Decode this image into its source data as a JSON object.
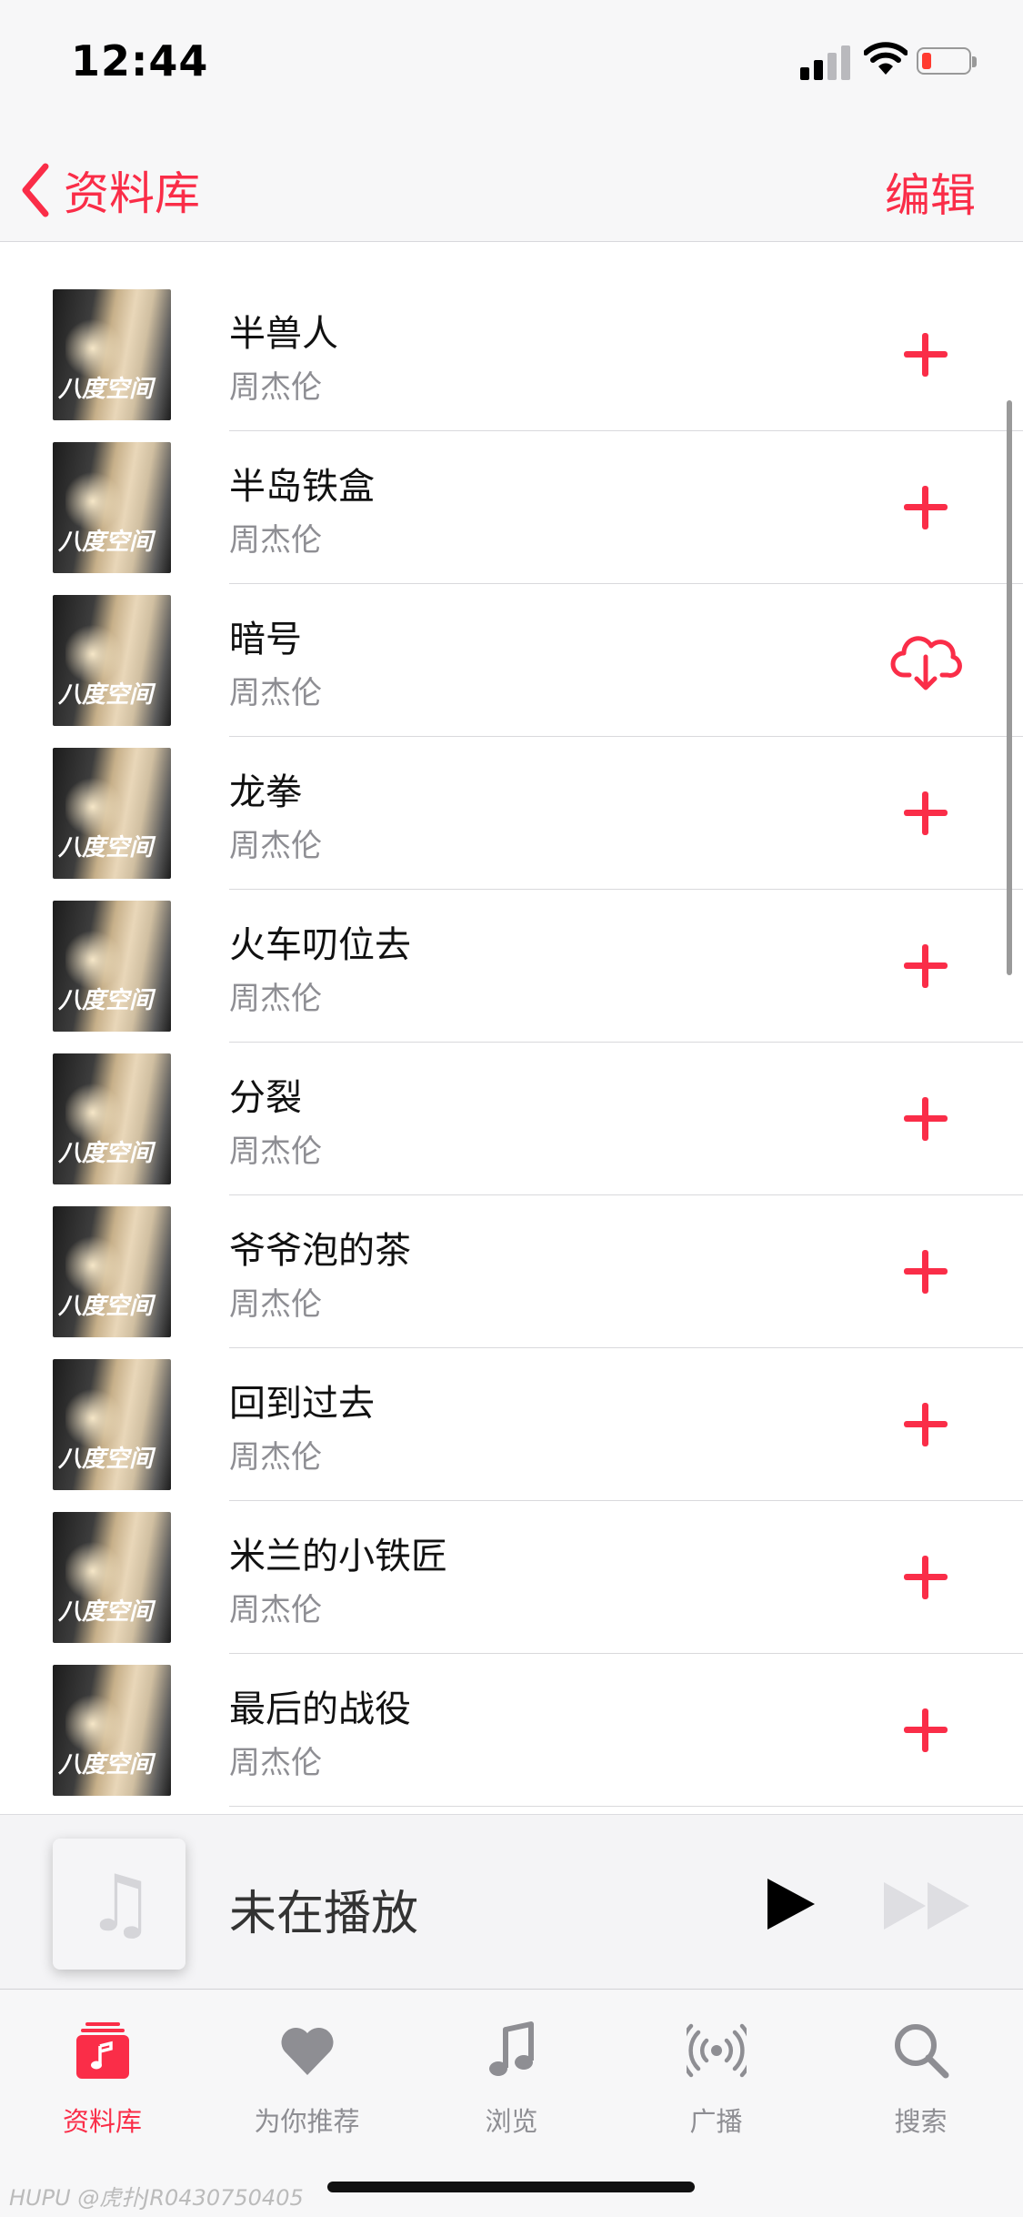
{
  "status_bar": {
    "time": "12:44"
  },
  "nav": {
    "back_label": "资料库",
    "edit_label": "编辑"
  },
  "songs": [
    {
      "title": "半兽人",
      "artist": "周杰伦",
      "action": "add-icon"
    },
    {
      "title": "半岛铁盒",
      "artist": "周杰伦",
      "action": "add-icon"
    },
    {
      "title": "暗号",
      "artist": "周杰伦",
      "action": "cloud-download-icon"
    },
    {
      "title": "龙拳",
      "artist": "周杰伦",
      "action": "add-icon"
    },
    {
      "title": "火车叨位去",
      "artist": "周杰伦",
      "action": "add-icon"
    },
    {
      "title": "分裂",
      "artist": "周杰伦",
      "action": "add-icon"
    },
    {
      "title": "爷爷泡的茶",
      "artist": "周杰伦",
      "action": "add-icon"
    },
    {
      "title": "回到过去",
      "artist": "周杰伦",
      "action": "add-icon"
    },
    {
      "title": "米兰的小铁匠",
      "artist": "周杰伦",
      "action": "add-icon"
    },
    {
      "title": "最后的战役",
      "artist": "周杰伦",
      "action": "add-icon"
    }
  ],
  "mini_player": {
    "title": "未在播放"
  },
  "tabs": [
    {
      "label": "资料库",
      "icon": "library-icon",
      "active": true
    },
    {
      "label": "为你推荐",
      "icon": "heart-icon",
      "active": false
    },
    {
      "label": "浏览",
      "icon": "music-note-icon",
      "active": false
    },
    {
      "label": "广播",
      "icon": "radio-icon",
      "active": false
    },
    {
      "label": "搜索",
      "icon": "search-icon",
      "active": false
    }
  ],
  "watermark": "HUPU @虎扑JR0430750405",
  "colors": {
    "accent": "#fa2d48",
    "secondary_text": "#8e8e93"
  }
}
